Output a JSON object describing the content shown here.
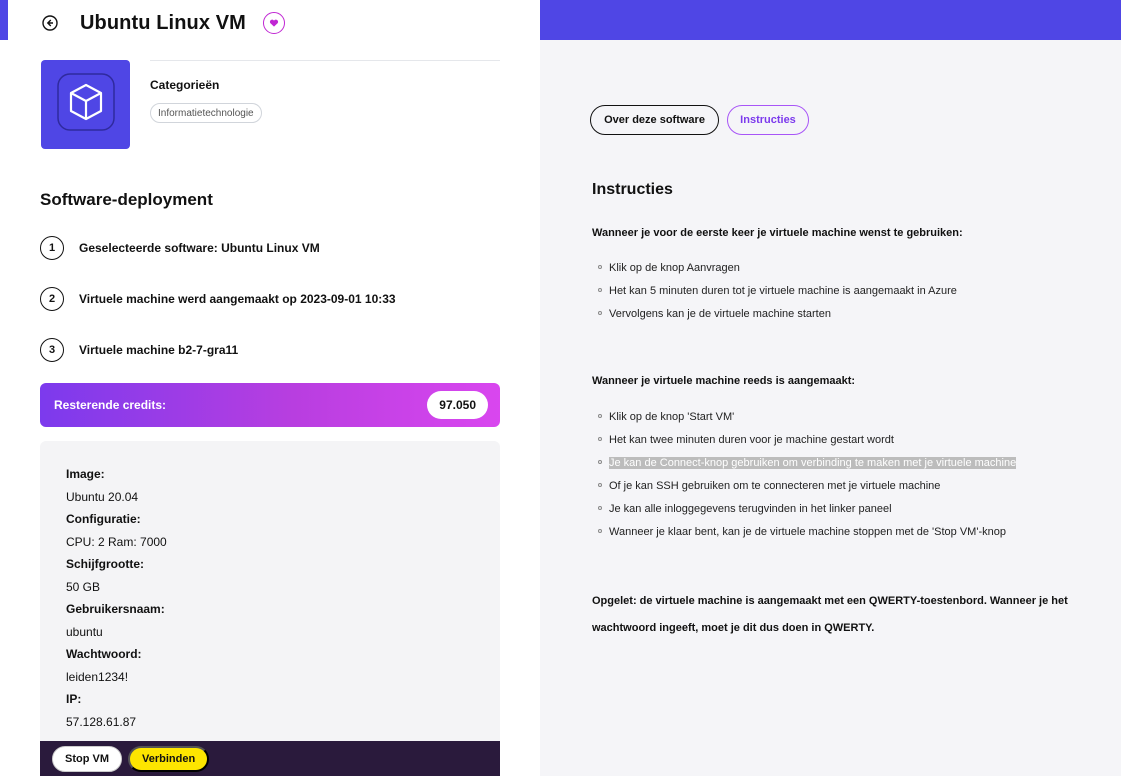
{
  "header": {
    "title": "Ubuntu Linux VM",
    "back_icon": "arrow-left-circle-icon",
    "favorite_icon": "heart-icon"
  },
  "app": {
    "icon": "cube-icon",
    "categories_label": "Categorieën",
    "category_tag": "Informatietechnologie"
  },
  "deployment": {
    "title": "Software-deployment",
    "steps": [
      {
        "number": "1",
        "text": "Geselecteerde software: Ubuntu Linux VM"
      },
      {
        "number": "2",
        "text": "Virtuele machine werd aangemaakt op 2023-09-01 10:33"
      },
      {
        "number": "3",
        "text": "Virtuele machine b2-7-gra11"
      }
    ]
  },
  "credits": {
    "label": "Resterende credits:",
    "value": "97.050"
  },
  "vm_info": {
    "image_label": "Image:",
    "image_value": "Ubuntu 20.04",
    "config_label": "Configuratie:",
    "config_value": "CPU: 2 Ram: 7000",
    "disk_label": "Schijfgrootte:",
    "disk_value": "50 GB",
    "user_label": "Gebruikersnaam:",
    "user_value": "ubuntu",
    "password_label": "Wachtwoord:",
    "password_value": "leiden1234!",
    "ip_label": "IP:",
    "ip_value": "57.128.61.87"
  },
  "actions": {
    "stop": "Stop VM",
    "connect": "Verbinden"
  },
  "tabs": {
    "about": "Over deze software",
    "instructions": "Instructies"
  },
  "instructions": {
    "title": "Instructies",
    "first_heading": "Wanneer je voor de eerste keer je virtuele machine wenst te gebruiken:",
    "first_items": [
      "Klik op de knop Aanvragen",
      "Het kan 5 minuten duren tot je virtuele machine is aangemaakt in Azure",
      "Vervolgens kan je de virtuele machine starten"
    ],
    "second_heading": "Wanneer je virtuele machine reeds is aangemaakt:",
    "second_items": [
      "Klik op de knop 'Start VM'",
      "Het kan twee minuten duren voor je machine gestart wordt",
      "Je kan de Connect-knop gebruiken om verbinding te maken met je virtuele machine",
      "Of je kan SSH gebruiken om te connecteren met je virtuele machine",
      "Je kan alle inloggegevens terugvinden in het linker paneel",
      "Wanneer je klaar bent, kan je de virtuele machine stoppen met de 'Stop VM'-knop"
    ],
    "note": "Opgelet: de virtuele machine is aangemaakt met een QWERTY-toestenbord. Wanneer je het wachtwoord ingeeft, moet je dit dus doen in QWERTY."
  },
  "colors": {
    "brand": "#4f46e5",
    "accent_purple": "#a855f7",
    "connect_yellow": "#fde500",
    "action_bar": "#2a1a3c"
  }
}
